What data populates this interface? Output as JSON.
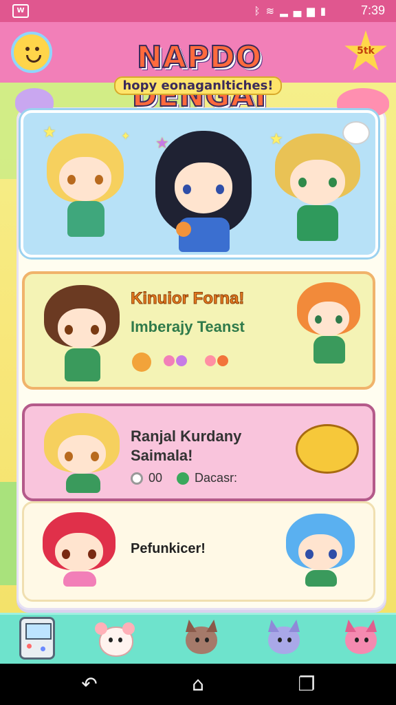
{
  "status_bar": {
    "time": "7:39",
    "app_badge": "W",
    "icons": [
      "nfc-icon",
      "wifi-icon",
      "signal-icon",
      "battery-icon"
    ]
  },
  "header": {
    "logo": "NAPDO DENGAI",
    "subtitle": "hopy eonaganltiches!",
    "badge_right": "5tk"
  },
  "cards": [
    {
      "id": "featured",
      "characters": [
        "blonde-girl",
        "black-hair-girl",
        "blonde-boy"
      ]
    },
    {
      "id": "card2",
      "title": "Kinuior Forna!",
      "subtitle": "Imberajy Teanst"
    },
    {
      "id": "card3",
      "title_line1": "Ranjal Kurdany",
      "title_line2": "Saimala!",
      "count": "00",
      "meta_label": "Dacasr:"
    },
    {
      "id": "card4",
      "title": "Pefunkicer!"
    }
  ],
  "bottom_bar": {
    "items": [
      "handheld-game-icon",
      "mouse-pet-icon",
      "cat-pet-icon",
      "blue-cat-pet-icon",
      "pink-cat-pet-icon"
    ]
  },
  "nav_bar": {
    "items": [
      "back-icon",
      "home-icon",
      "recents-icon"
    ]
  },
  "colors": {
    "status_bar": "#e0578f",
    "header": "#f27fb8",
    "bottom_bar": "#6ee3cc",
    "card2_border": "#f0b36b",
    "card3_border": "#b45a8a"
  }
}
